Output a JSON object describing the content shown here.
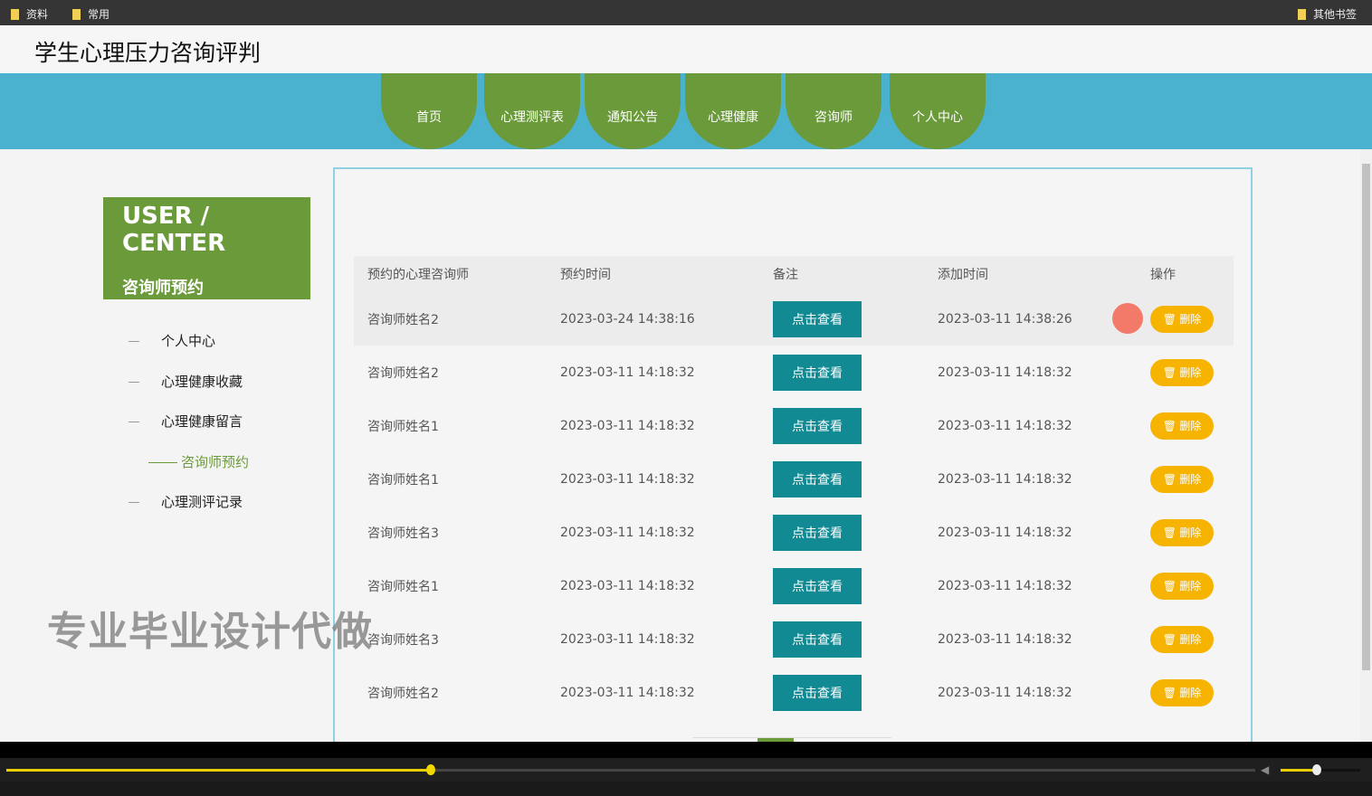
{
  "bookmarks": {
    "items": [
      "资料",
      "常用"
    ],
    "other": "其他书签"
  },
  "site_title": "学生心理压力咨询评判",
  "nav": [
    "首页",
    "心理测评表",
    "通知公告",
    "心理健康",
    "咨询师",
    "个人中心"
  ],
  "user_center": {
    "title": "USER / CENTER",
    "subtitle": "咨询师预约"
  },
  "sidebar": [
    {
      "label": "个人中心"
    },
    {
      "label": "心理健康收藏"
    },
    {
      "label": "心理健康留言"
    },
    {
      "label": "咨询师预约",
      "active": true
    },
    {
      "label": "心理测评记录"
    }
  ],
  "table": {
    "headers": [
      "预约的心理咨询师",
      "预约时间",
      "备注",
      "添加时间",
      "操作"
    ],
    "view_label": "点击查看",
    "delete_label": "删除",
    "rows": [
      [
        "咨询师姓名2",
        "2023-03-24 14:38:16",
        "2023-03-11 14:38:26"
      ],
      [
        "咨询师姓名2",
        "2023-03-11 14:18:32",
        "2023-03-11 14:18:32"
      ],
      [
        "咨询师姓名1",
        "2023-03-11 14:18:32",
        "2023-03-11 14:18:32"
      ],
      [
        "咨询师姓名1",
        "2023-03-11 14:18:32",
        "2023-03-11 14:18:32"
      ],
      [
        "咨询师姓名3",
        "2023-03-11 14:18:32",
        "2023-03-11 14:18:32"
      ],
      [
        "咨询师姓名1",
        "2023-03-11 14:18:32",
        "2023-03-11 14:18:32"
      ],
      [
        "咨询师姓名3",
        "2023-03-11 14:18:32",
        "2023-03-11 14:18:32"
      ],
      [
        "咨询师姓名2",
        "2023-03-11 14:18:32",
        "2023-03-11 14:18:32"
      ]
    ]
  },
  "watermark": "专业毕业设计代做",
  "player": {
    "progress_percent": 34,
    "volume_percent": 45
  },
  "colors": {
    "green": "#6b9a3a",
    "blue": "#4ab2cf",
    "teal": "#128a94",
    "orange": "#f6b400"
  }
}
